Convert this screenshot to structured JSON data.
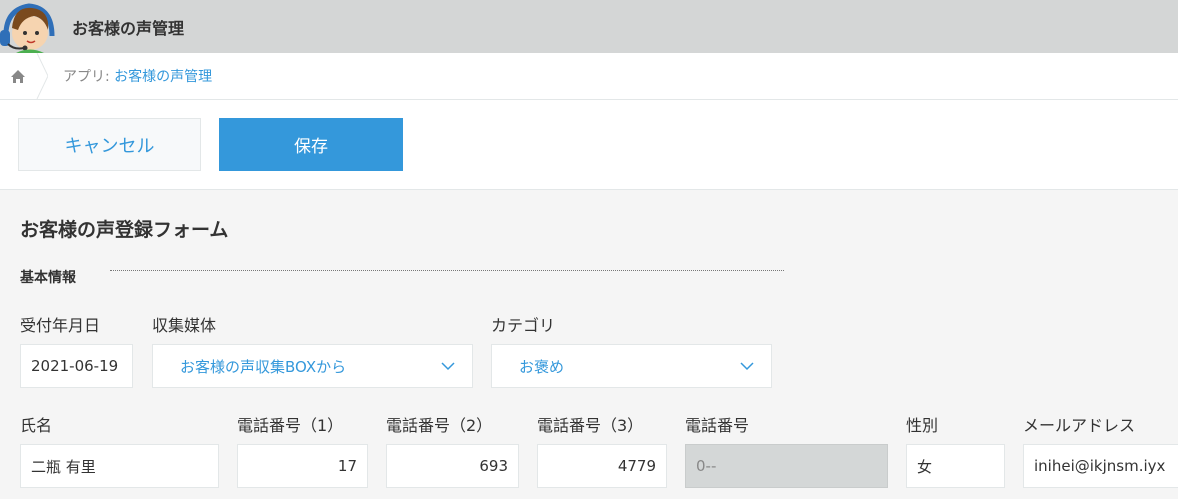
{
  "header": {
    "app_title": "お客様の声管理"
  },
  "breadcrumb": {
    "prefix": "アプリ: ",
    "app_link": "お客様の声管理"
  },
  "toolbar": {
    "cancel_label": "キャンセル",
    "save_label": "保存"
  },
  "form": {
    "title": "お客様の声登録フォーム",
    "section_basic": "基本情報",
    "fields": {
      "received_date": {
        "label": "受付年月日",
        "value": "2021-06-19"
      },
      "channel": {
        "label": "収集媒体",
        "value": "お客様の声収集BOXから"
      },
      "category": {
        "label": "カテゴリ",
        "value": "お褒め"
      },
      "name": {
        "label": "氏名",
        "value": "二瓶 有里"
      },
      "phone1": {
        "label": "電話番号（1）",
        "value": "17"
      },
      "phone2": {
        "label": "電話番号（2）",
        "value": "693"
      },
      "phone3": {
        "label": "電話番号（3）",
        "value": "4779"
      },
      "phone": {
        "label": "電話番号",
        "value": "0--"
      },
      "gender": {
        "label": "性別",
        "value": "女"
      },
      "email": {
        "label": "メールアドレス",
        "value": "inihei@ikjnsm.iyx"
      }
    }
  },
  "colors": {
    "accent": "#3498db",
    "topbar": "#d4d6d6",
    "page_bg": "#f5f5f5"
  }
}
